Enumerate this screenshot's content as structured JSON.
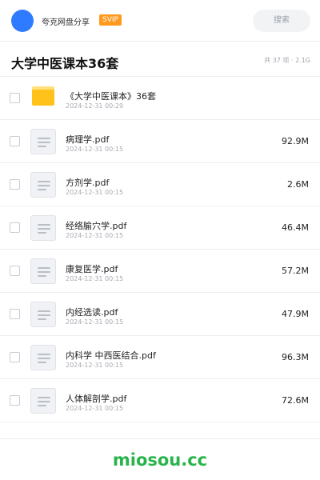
{
  "header": {
    "share_name": "夸克网盘分享",
    "badge": "SVIP",
    "search_label": "搜索"
  },
  "folder": {
    "title": "大学中医课本36套",
    "meta": "共 37 项 · 2.1G"
  },
  "files": [
    {
      "type": "folder",
      "name": "《大学中医课本》36套",
      "date": "2024-12-31 00:29",
      "size": ""
    },
    {
      "type": "pdf",
      "name": "病理学.pdf",
      "date": "2024-12-31 00:15",
      "size": "92.9M"
    },
    {
      "type": "pdf",
      "name": "方剂学.pdf",
      "date": "2024-12-31 00:15",
      "size": "2.6M"
    },
    {
      "type": "pdf",
      "name": "经络腧穴学.pdf",
      "date": "2024-12-31 00:15",
      "size": "46.4M"
    },
    {
      "type": "pdf",
      "name": "康复医学.pdf",
      "date": "2024-12-31 00:15",
      "size": "57.2M"
    },
    {
      "type": "pdf",
      "name": "内经选读.pdf",
      "date": "2024-12-31 00:15",
      "size": "47.9M"
    },
    {
      "type": "pdf",
      "name": "内科学 中西医结合.pdf",
      "date": "2024-12-31 00:15",
      "size": "96.3M"
    },
    {
      "type": "pdf",
      "name": "人体解剖学.pdf",
      "date": "2024-12-31 00:15",
      "size": "72.6M"
    }
  ],
  "footer": {
    "watermark": "miosou.cc"
  },
  "colors": {
    "accent": "#2f7bff",
    "badge": "#ff9a1f",
    "folder": "#ffc21a",
    "watermark": "#28b44a"
  }
}
